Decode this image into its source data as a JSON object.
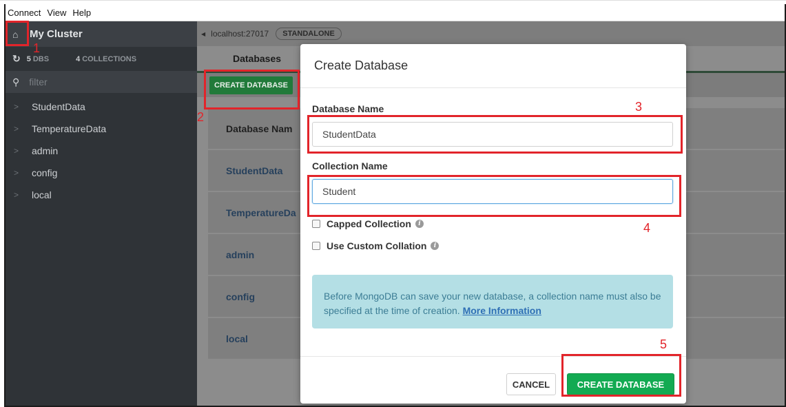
{
  "menu": [
    "Connect",
    "View",
    "Help"
  ],
  "sidebar": {
    "cluster_name": "My Cluster",
    "dbs_count": "5",
    "dbs_label": "DBS",
    "collections_count": "4",
    "collections_label": "COLLECTIONS",
    "filter_placeholder": "filter",
    "items": [
      {
        "label": "StudentData"
      },
      {
        "label": "TemperatureData"
      },
      {
        "label": "admin"
      },
      {
        "label": "config"
      },
      {
        "label": "local"
      }
    ]
  },
  "main": {
    "host": "localhost:27017",
    "mode": "STANDALONE",
    "tab": "Databases",
    "create_button": "CREATE DATABASE",
    "column_header": "Database Nam",
    "rows": [
      "StudentData",
      "TemperatureDa",
      "admin",
      "config",
      "local"
    ]
  },
  "modal": {
    "title": "Create Database",
    "db_name_label": "Database Name",
    "db_name_value": "StudentData",
    "coll_name_label": "Collection Name",
    "coll_name_value": "Student",
    "capped_label": "Capped Collection",
    "collation_label": "Use Custom Collation",
    "note_text": "Before MongoDB can save your new database, a collection name must also be specified at the time of creation.",
    "note_link": "More Information",
    "cancel": "CANCEL",
    "create": "CREATE DATABASE"
  },
  "annotations": [
    "1",
    "2",
    "3",
    "4",
    "5"
  ],
  "colors": {
    "annotation": "#e2242a",
    "primary_green": "#13aa52",
    "sidebar_bg": "#2f3337"
  }
}
